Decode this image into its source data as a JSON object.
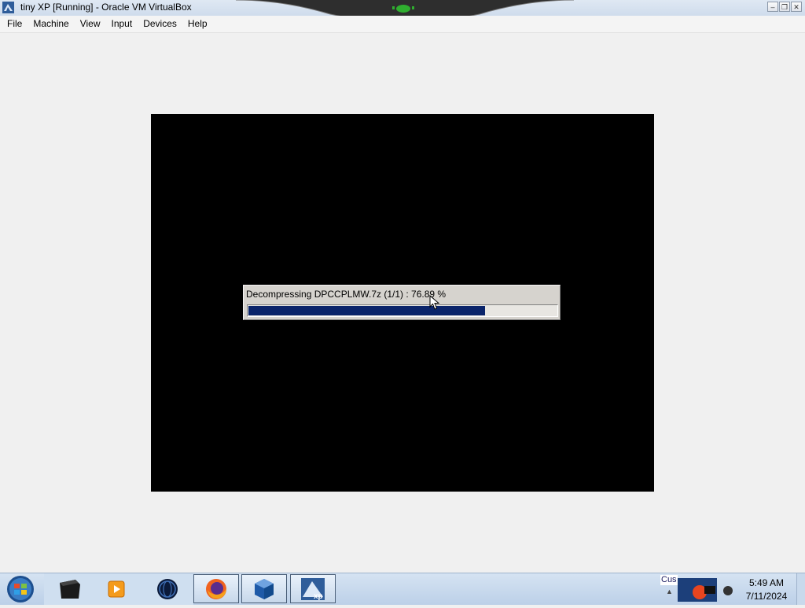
{
  "window": {
    "title": "tiny XP [Running] - Oracle VM VirtualBox",
    "controls": [
      "minimize",
      "restore",
      "close"
    ]
  },
  "menu": {
    "items": [
      "File",
      "Machine",
      "View",
      "Input",
      "Devices",
      "Help"
    ]
  },
  "vm": {
    "dialog": {
      "message": "Decompressing DPCCPLMW.7z  (1/1) : 76.89 %",
      "progress_fraction": 0.7689,
      "progress_color": "#0a246a"
    }
  },
  "taskbar": {
    "icons": [
      "start-orb-icon",
      "terminal-icon",
      "media-player-icon",
      "globe-icon",
      "firefox-icon",
      "virtualbox-icon",
      "tiny-xp-icon"
    ],
    "tray": {
      "notification_text": "Cus",
      "time": "5:49 AM",
      "date": "7/11/2024"
    }
  },
  "colors": {
    "titlebar": "#dfe8f3",
    "vm_background": "#000000",
    "dialog_background": "#d6d3ce",
    "taskbar": "#c8d9ec"
  }
}
